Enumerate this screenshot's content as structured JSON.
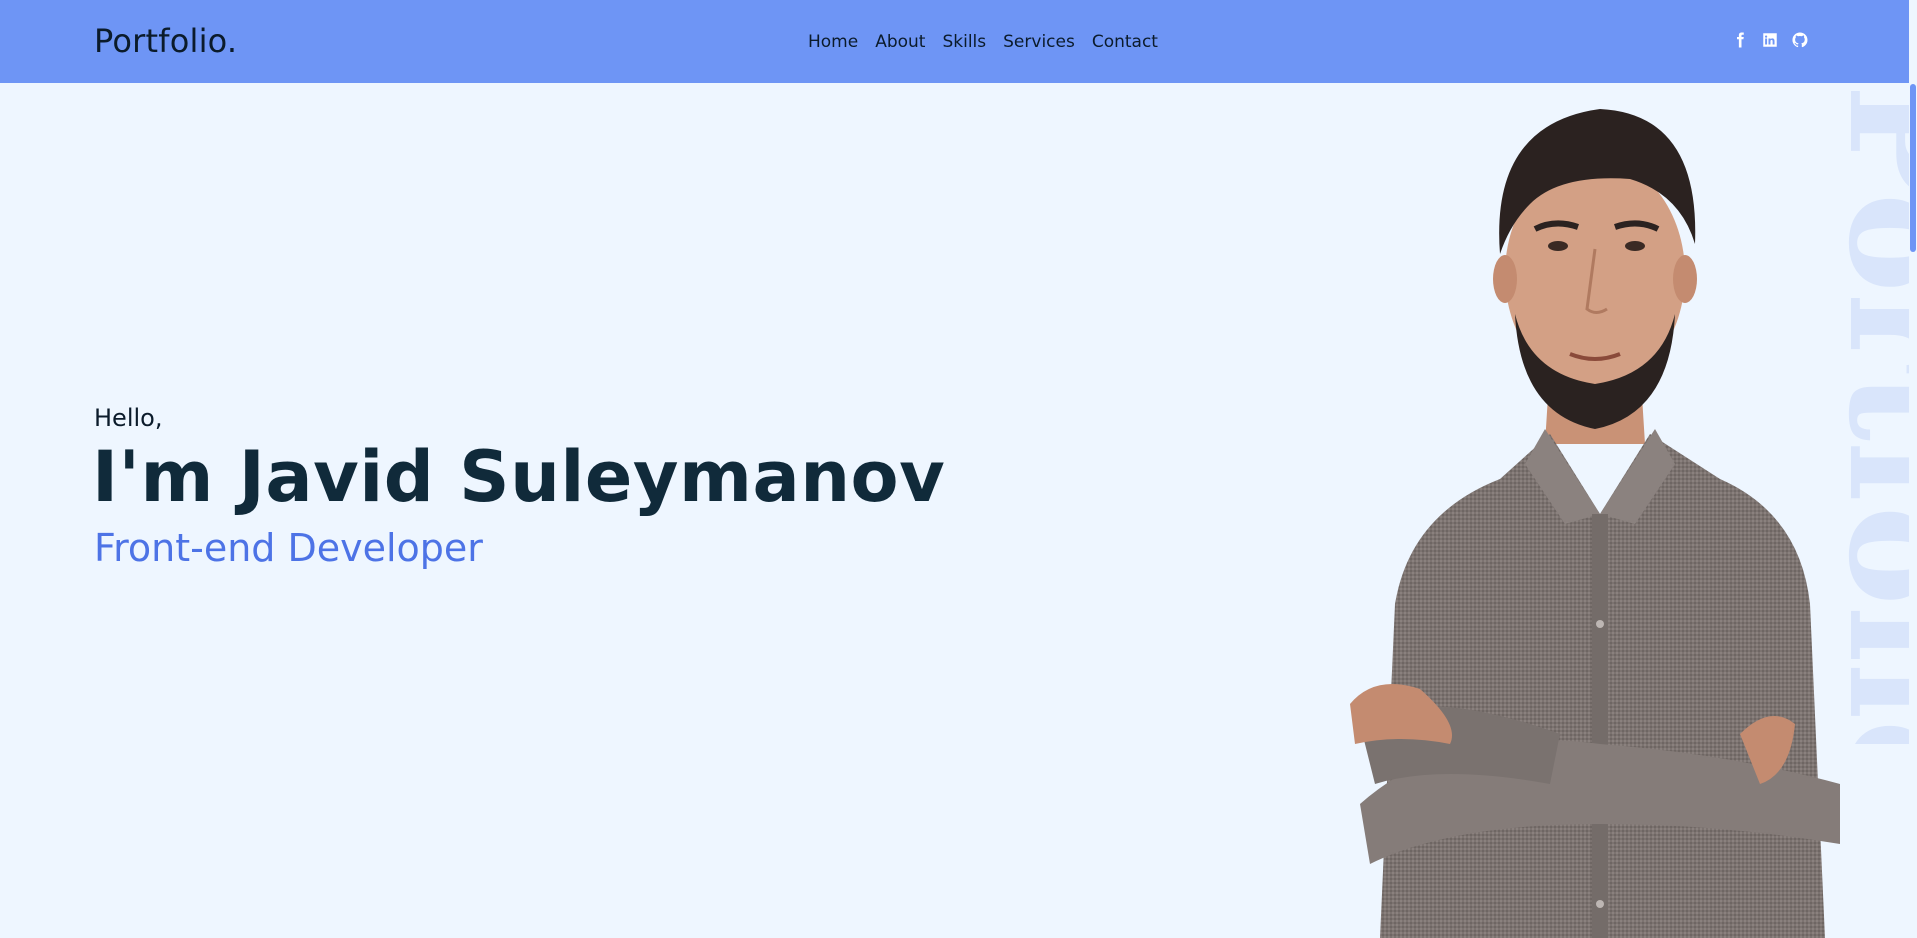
{
  "header": {
    "logo": "Portfolio.",
    "nav": [
      {
        "label": "Home"
      },
      {
        "label": "About"
      },
      {
        "label": "Skills"
      },
      {
        "label": "Services"
      },
      {
        "label": "Contact"
      }
    ],
    "socials": [
      "facebook-icon",
      "linkedin-icon",
      "github-icon"
    ]
  },
  "hero": {
    "greeting": "Hello,",
    "name": "I'm Javid Suleymanov",
    "role": "Front-end Developer",
    "watermark": "Portfolio"
  },
  "colors": {
    "header_bg": "#6e95f5",
    "page_bg": "#eef6ff",
    "accent": "#4d73e6",
    "heading": "#102a3a"
  }
}
